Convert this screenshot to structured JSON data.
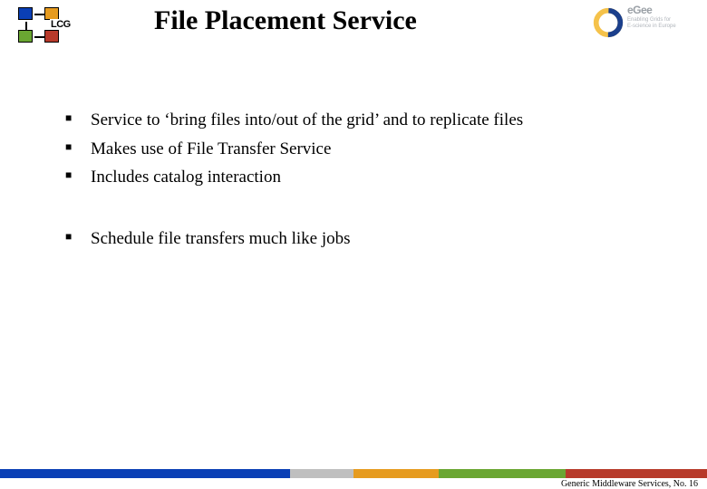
{
  "header": {
    "lcg_label": "LCG",
    "title": "File Placement Service",
    "egee_text": "eGee",
    "egee_sub": "Enabling Grids for\nE-science in Europe"
  },
  "bullets_group1": [
    "Service to ‘bring files into/out of the grid’ and to replicate files",
    "Makes use of File Transfer Service",
    "Includes catalog interaction"
  ],
  "bullets_group2": [
    "Schedule file transfers much like jobs"
  ],
  "footer": {
    "text": "Generic Middleware Services, No. 16"
  }
}
